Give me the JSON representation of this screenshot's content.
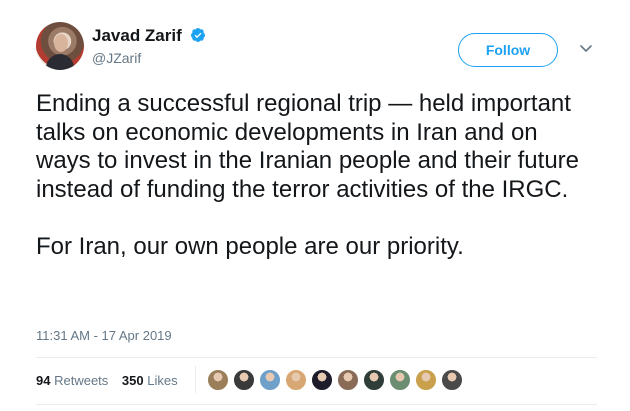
{
  "author": {
    "name": "Javad Zarif",
    "handle": "@JZarif",
    "verified": true
  },
  "follow_label": "Follow",
  "tweet": {
    "text": "Ending a successful regional trip — held important talks on economic developments in Iran and on ways to invest in the Iranian people and their future instead of funding the terror activities of the IRGC.\n\nFor Iran, our own people are our priority.",
    "timestamp": "11:31 AM - 17 Apr 2019"
  },
  "stats": {
    "retweets_count": "94",
    "retweets_label": "Retweets",
    "likes_count": "350",
    "likes_label": "Likes"
  },
  "likers": [
    {
      "bg": "#9a7f5a"
    },
    {
      "bg": "#3a3a3a"
    },
    {
      "bg": "#6fa0c9"
    },
    {
      "bg": "#d8a774"
    },
    {
      "bg": "#1c1c2a"
    },
    {
      "bg": "#8a6c56"
    },
    {
      "bg": "#2f3e38"
    },
    {
      "bg": "#6b8d70"
    },
    {
      "bg": "#c9a04b"
    },
    {
      "bg": "#4a4a4a"
    }
  ],
  "colors": {
    "accent": "#1da1f2",
    "text": "#14171a",
    "muted": "#657786"
  }
}
